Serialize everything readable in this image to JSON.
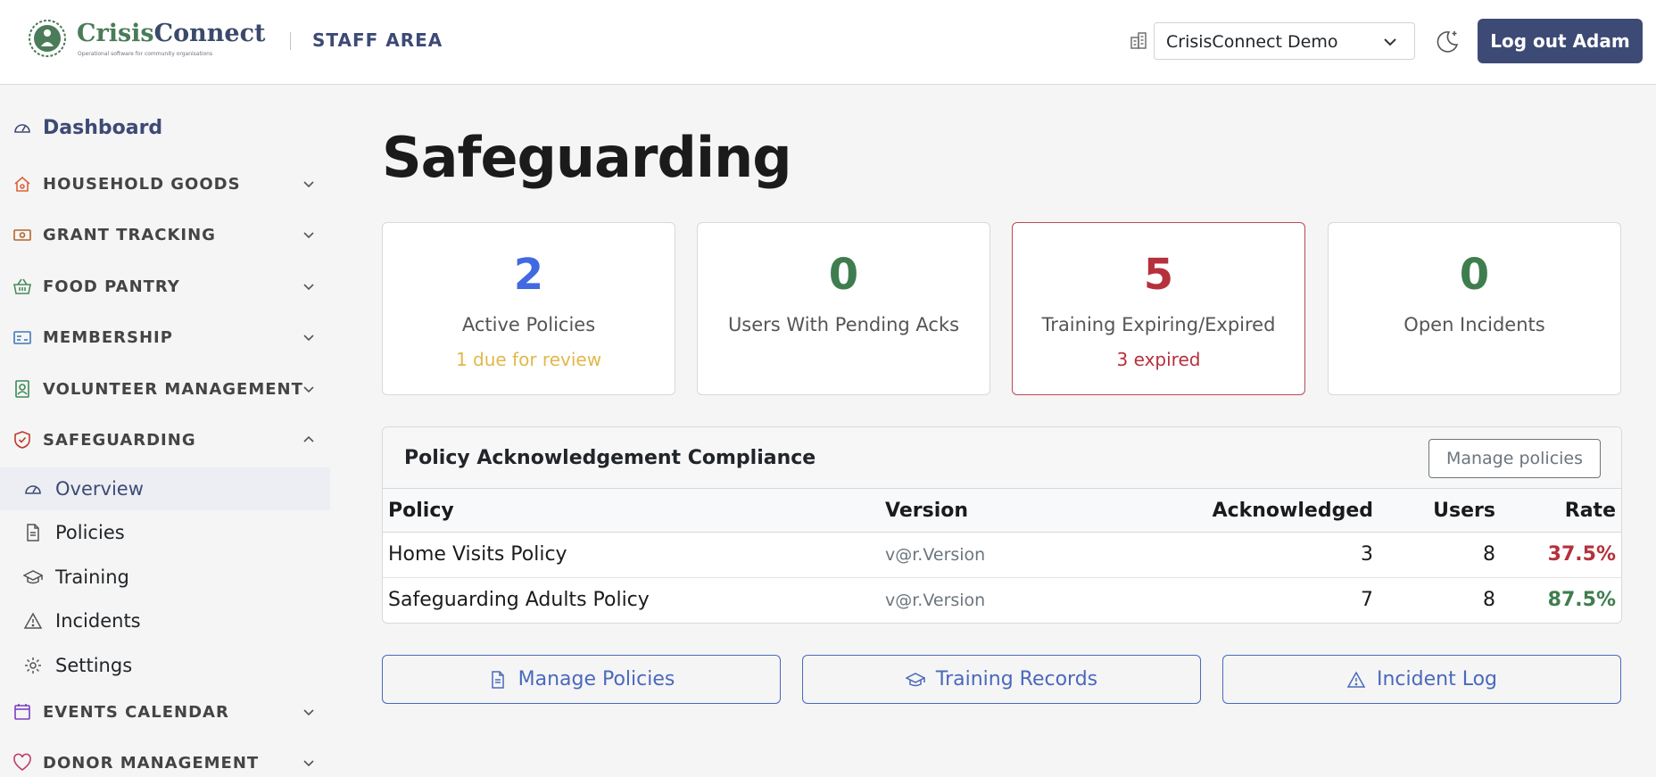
{
  "header": {
    "brand_name_part1": "Crisis",
    "brand_name_part2": "Connect",
    "brand_tagline": "Operational software for community organisations",
    "area_label": "STAFF AREA",
    "org_selected": "CrisisConnect Demo",
    "logout_label": "Log out Adam"
  },
  "sidebar": {
    "dashboard_label": "Dashboard",
    "sections": [
      {
        "label": "HOUSEHOLD GOODS",
        "icon": "home-icon",
        "color": "#d9643a"
      },
      {
        "label": "GRANT TRACKING",
        "icon": "money-icon",
        "color": "#b5652a"
      },
      {
        "label": "FOOD PANTRY",
        "icon": "basket-icon",
        "color": "#4a8c5a"
      },
      {
        "label": "MEMBERSHIP",
        "icon": "id-card-icon",
        "color": "#3d7ab8"
      },
      {
        "label": "VOLUNTEER MANAGEMENT",
        "icon": "badge-icon",
        "color": "#3a8a55"
      },
      {
        "label": "SAFEGUARDING",
        "icon": "shield-icon",
        "color": "#c0392b"
      },
      {
        "label": "EVENTS CALENDAR",
        "icon": "calendar-icon",
        "color": "#7b3fbf"
      },
      {
        "label": "DONOR MANAGEMENT",
        "icon": "heart-icon",
        "color": "#c0396b"
      }
    ],
    "safeguarding_items": [
      {
        "label": "Overview",
        "icon": "speedometer-icon"
      },
      {
        "label": "Policies",
        "icon": "document-icon"
      },
      {
        "label": "Training",
        "icon": "graduation-cap-icon"
      },
      {
        "label": "Incidents",
        "icon": "warning-icon"
      },
      {
        "label": "Settings",
        "icon": "gear-icon"
      }
    ]
  },
  "main": {
    "title": "Safeguarding",
    "cards": [
      {
        "value": "2",
        "label": "Active Policies",
        "sub": "1 due for review",
        "value_color": "#4169e1",
        "sub_color": "#e0b84c"
      },
      {
        "value": "0",
        "label": "Users With Pending Acks",
        "sub": "",
        "value_color": "#3f7d4f",
        "sub_color": ""
      },
      {
        "value": "5",
        "label": "Training Expiring/Expired",
        "sub": "3 expired",
        "value_color": "#b5313c",
        "sub_color": "#b5313c"
      },
      {
        "value": "0",
        "label": "Open Incidents",
        "sub": "",
        "value_color": "#3f7d4f",
        "sub_color": ""
      }
    ],
    "compliance": {
      "title": "Policy Acknowledgement Compliance",
      "manage_label": "Manage policies",
      "columns": [
        "Policy",
        "Version",
        "Acknowledged",
        "Users",
        "Rate"
      ],
      "rows": [
        {
          "policy": "Home Visits Policy",
          "version": "v@r.Version",
          "acknowledged": "3",
          "users": "8",
          "rate": "37.5%",
          "rate_color": "#b5313c"
        },
        {
          "policy": "Safeguarding Adults Policy",
          "version": "v@r.Version",
          "acknowledged": "7",
          "users": "8",
          "rate": "87.5%",
          "rate_color": "#3f7d4f"
        }
      ]
    },
    "actions": [
      {
        "label": "Manage Policies",
        "icon": "document-icon"
      },
      {
        "label": "Training Records",
        "icon": "graduation-cap-icon"
      },
      {
        "label": "Incident Log",
        "icon": "warning-icon"
      }
    ]
  }
}
